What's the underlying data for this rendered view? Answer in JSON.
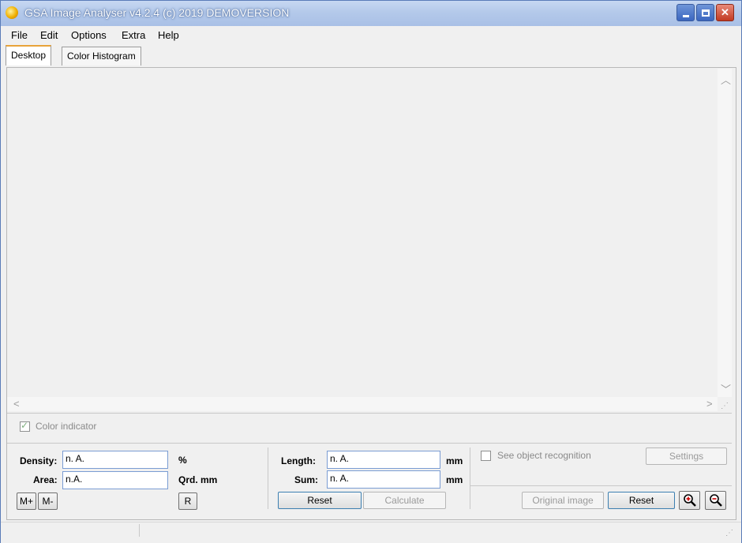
{
  "window": {
    "title": "GSA Image Analyser v4.2.4 (c) 2019   DEMOVERSION",
    "icon": "sun-app-icon",
    "controls": {
      "minimize": "minimize-icon",
      "maximize": "maximize-icon",
      "close": "close-icon"
    }
  },
  "menu": [
    "File",
    "Edit",
    "Options",
    "Extra",
    "Help"
  ],
  "tabs": [
    "Desktop",
    "Color Histogram"
  ],
  "color_indicator": {
    "label": "Color indicator",
    "checked": true
  },
  "measure": {
    "density_label": "Density:",
    "density_value": "n. A.",
    "density_unit": "%",
    "area_label": "Area:",
    "area_value": "n.A.",
    "area_unit": "Qrd. mm",
    "mplus": "M+",
    "mminus": "M-",
    "r_button": "R",
    "length_label": "Length:",
    "length_value": "n. A.",
    "length_unit": "mm",
    "sum_label": "Sum:",
    "sum_value": "n. A.",
    "sum_unit": "mm",
    "reset": "Reset",
    "calculate": "Calculate"
  },
  "objects": {
    "see_label": "See object recognition",
    "settings": "Settings",
    "original_image": "Original image",
    "reset": "Reset",
    "zoom_in_icon": "zoom-in-icon",
    "zoom_out_icon": "zoom-out-icon"
  }
}
